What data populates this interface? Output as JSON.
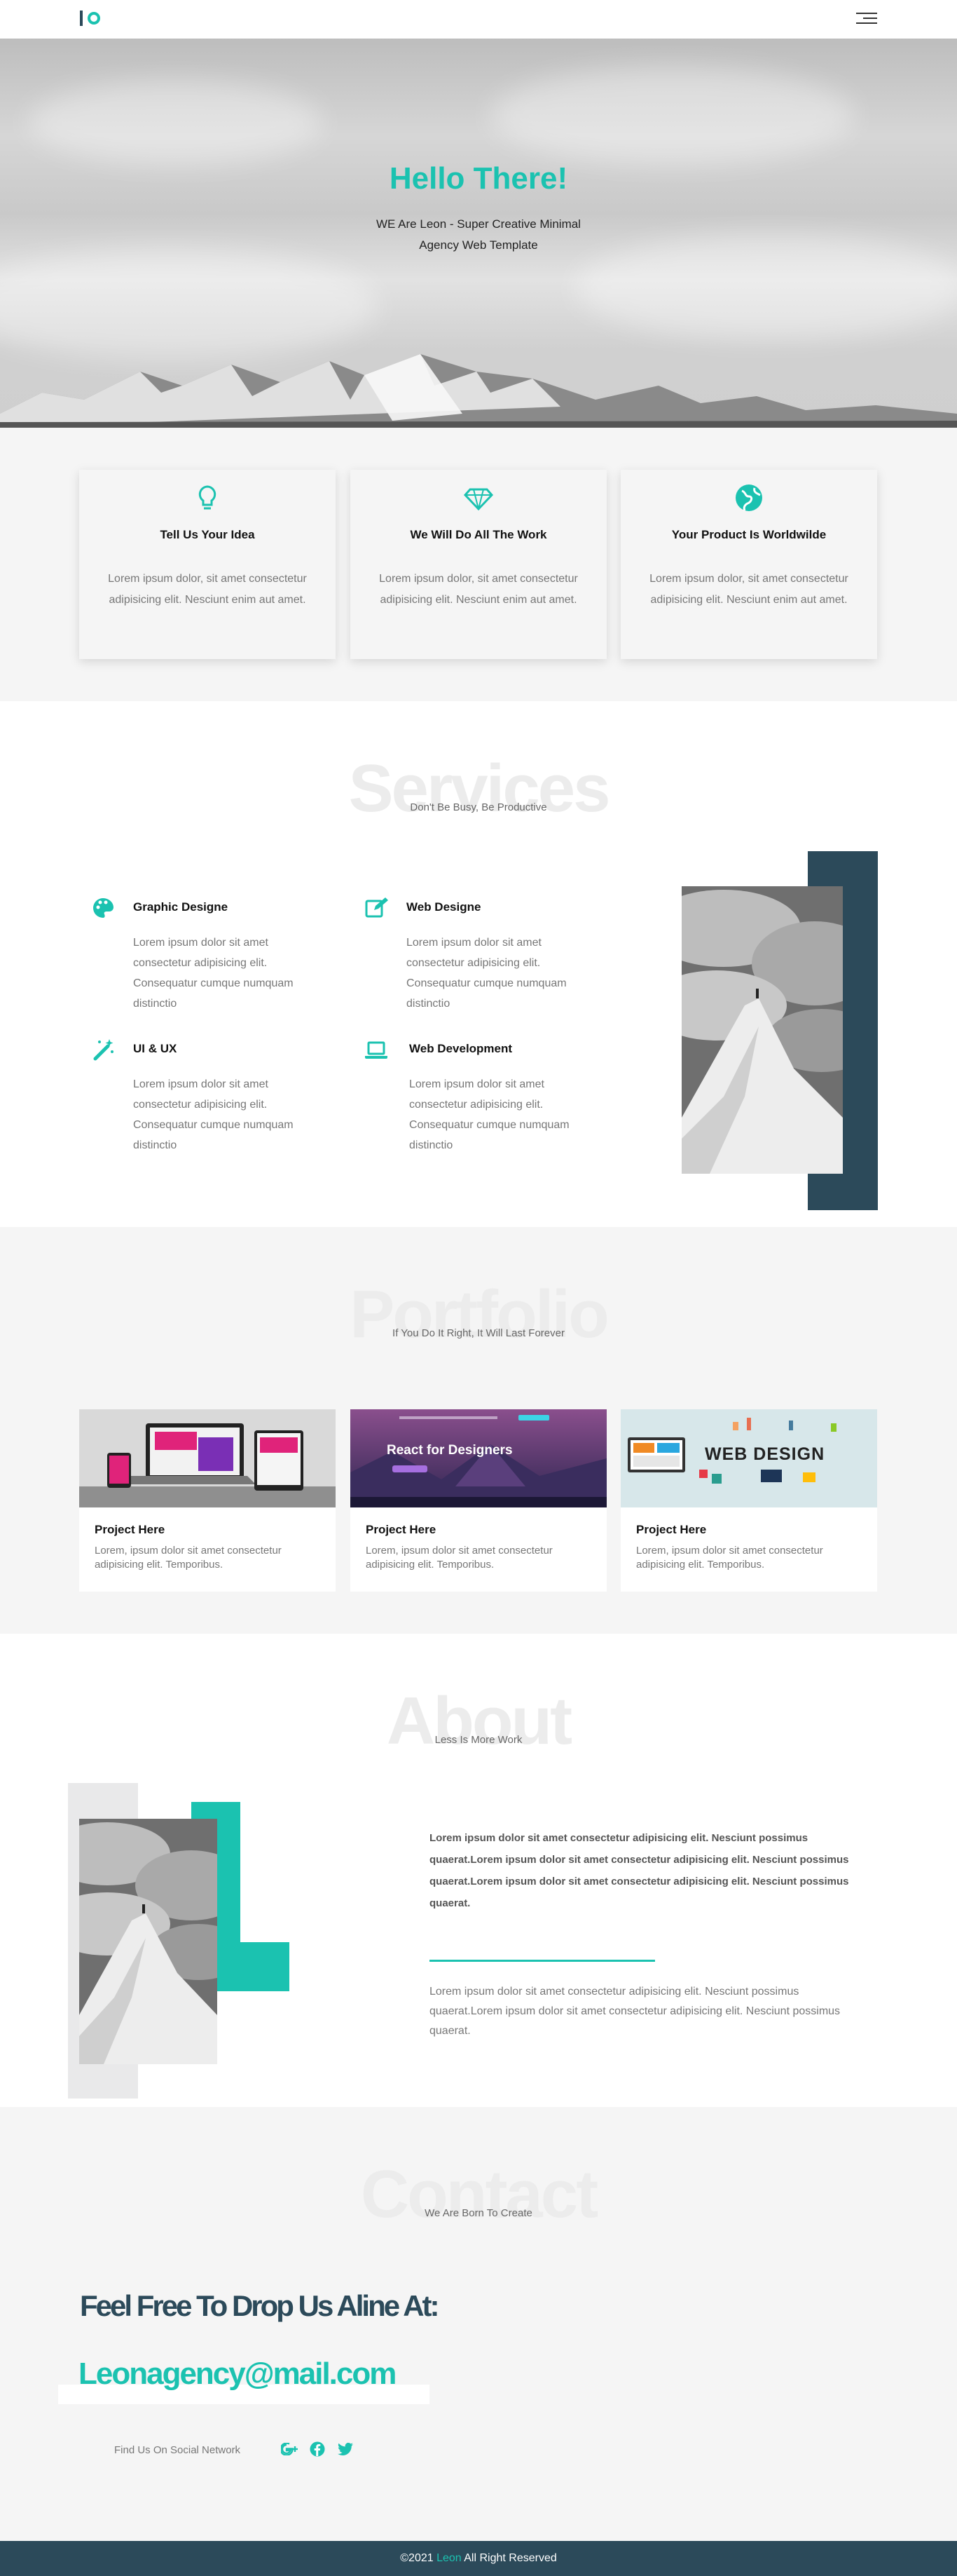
{
  "colors": {
    "accent": "#1bc2b0",
    "dark": "#2c4a5a"
  },
  "nav": {
    "logo": "IO",
    "menu_icon": "hamburger-icon"
  },
  "hero": {
    "title": "Hello There!",
    "subtitle_line1": "WE Are Leon - Super Creative Minimal",
    "subtitle_line2": "Agency Web Template"
  },
  "features": [
    {
      "icon": "lightbulb-icon",
      "title": "Tell Us Your Idea",
      "text": "Lorem ipsum dolor, sit amet consectetur adipisicing elit. Nesciunt enim aut amet."
    },
    {
      "icon": "diamond-icon",
      "title": "We Will Do All The Work",
      "text": "Lorem ipsum dolor, sit amet consectetur adipisicing elit. Nesciunt enim aut amet."
    },
    {
      "icon": "globe-icon",
      "title": "Your Product Is Worldwilde",
      "text": "Lorem ipsum dolor, sit amet consectetur adipisicing elit. Nesciunt enim aut amet."
    }
  ],
  "services": {
    "heading": "Services",
    "subheading": "Don't Be Busy, Be Productive",
    "items": [
      {
        "icon": "palette-icon",
        "title": "Graphic Designe",
        "text": "Lorem ipsum dolor sit amet consectetur adipisicing elit. Consequatur cumque numquam distinctio"
      },
      {
        "icon": "edit-icon",
        "title": "Web Designe",
        "text": "Lorem ipsum dolor sit amet consectetur adipisicing elit. Consequatur cumque numquam distinctio"
      },
      {
        "icon": "magic-wand-icon",
        "title": "UI & UX",
        "text": "Lorem ipsum dolor sit amet consectetur adipisicing elit. Consequatur cumque numquam distinctio"
      },
      {
        "icon": "laptop-icon",
        "title": "Web Development",
        "text": "Lorem ipsum dolor sit amet consectetur adipisicing elit. Consequatur cumque numquam distinctio"
      }
    ]
  },
  "portfolio": {
    "heading": "Portfolio",
    "subheading": "If You Do It Right, It Will Last Forever",
    "items": [
      {
        "title": "Project Here",
        "text": "Lorem, ipsum dolor sit amet consectetur adipisicing elit. Temporibus."
      },
      {
        "title": "Project Here",
        "text": "Lorem, ipsum dolor sit amet consectetur adipisicing elit. Temporibus.",
        "thumb_caption": "React for Designers"
      },
      {
        "title": "Project Here",
        "text": "Lorem, ipsum dolor sit amet consectetur adipisicing elit. Temporibus.",
        "thumb_caption": "WEB DESIGN"
      }
    ]
  },
  "about": {
    "heading": "About",
    "subheading": "Less Is More Work",
    "bold_text": "Lorem ipsum dolor sit amet consectetur adipisicing elit. Nesciunt possimus quaerat.Lorem ipsum dolor sit amet consectetur adipisicing elit. Nesciunt possimus quaerat.Lorem ipsum dolor sit amet consectetur adipisicing elit. Nesciunt possimus quaerat.",
    "text": "Lorem ipsum dolor sit amet consectetur adipisicing elit. Nesciunt possimus quaerat.Lorem ipsum dolor sit amet consectetur adipisicing elit. Nesciunt possimus quaerat."
  },
  "contact": {
    "heading": "Contact",
    "subheading": "We Are Born To Create",
    "headline": "Feel Free To Drop Us Aline At:",
    "email": "Leonagency@mail.com",
    "social_label": "Find Us On Social Network",
    "social_icons": [
      "google-plus-icon",
      "facebook-icon",
      "twitter-icon"
    ]
  },
  "footer": {
    "copyright": "©2021",
    "brand": "Leon",
    "rights": "All Right Reserved"
  }
}
